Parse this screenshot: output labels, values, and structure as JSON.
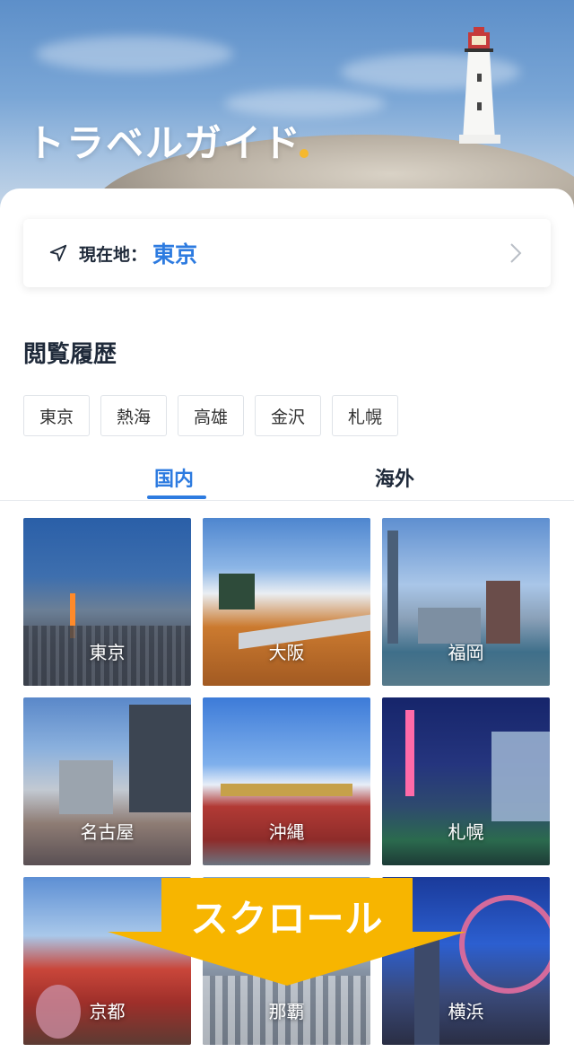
{
  "hero": {
    "title": "トラベルガイド"
  },
  "location": {
    "label": "現在地：",
    "value": "東京"
  },
  "history": {
    "title": "閲覧履歴",
    "items": [
      "東京",
      "熱海",
      "高雄",
      "金沢",
      "札幌"
    ]
  },
  "tabs": {
    "domestic": "国内",
    "overseas": "海外"
  },
  "cities": [
    {
      "name": "東京"
    },
    {
      "name": "大阪"
    },
    {
      "name": "福岡"
    },
    {
      "name": "名古屋"
    },
    {
      "name": "沖縄"
    },
    {
      "name": "札幌"
    },
    {
      "name": "京都"
    },
    {
      "name": "那覇"
    },
    {
      "name": "横浜"
    }
  ],
  "overlay": {
    "scroll": "スクロール"
  },
  "colors": {
    "accent": "#2d7be0",
    "highlight": "#f5b82e",
    "banner": "#f7b500"
  }
}
